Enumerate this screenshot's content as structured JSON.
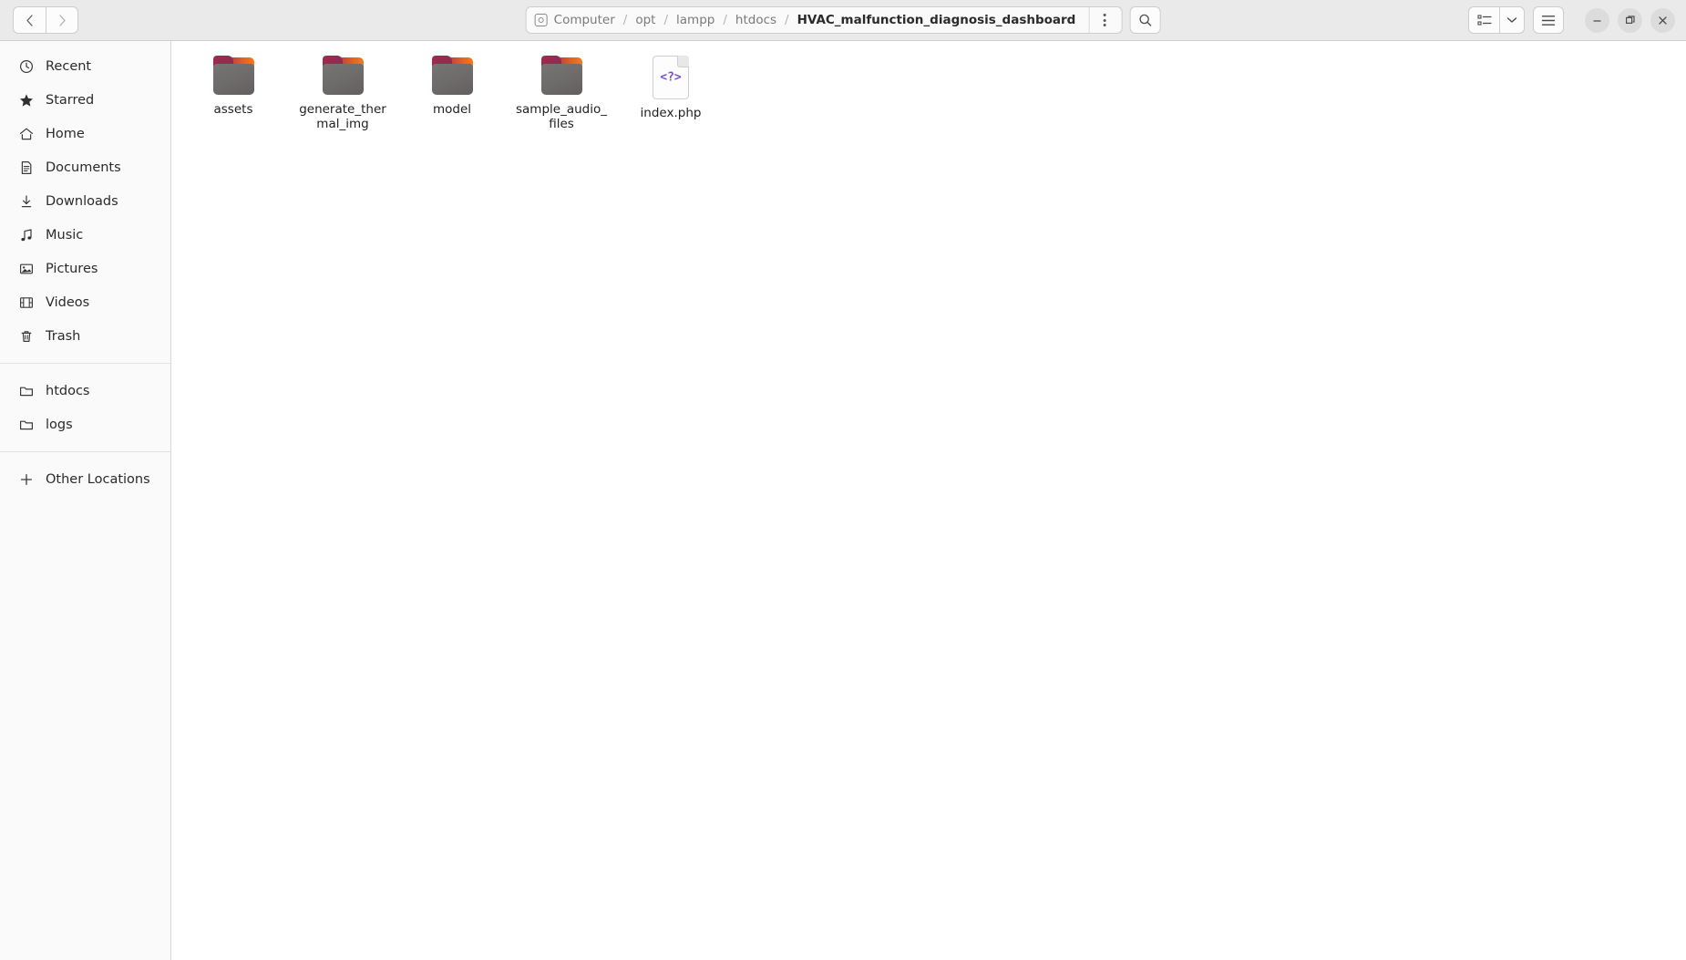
{
  "window": {
    "minimize_label": "—",
    "maximize_label": "❐",
    "close_label": "✕"
  },
  "toolbar": {
    "back_label": "‹",
    "forward_label": "›",
    "back_name": "back-button",
    "forward_name": "forward-button",
    "menu_dots": "⋮",
    "search_name": "search-icon",
    "view_toggle_name": "view-mode-toggle",
    "hamburger_name": "main-menu-button"
  },
  "breadcrumb": {
    "root_icon": "disk-icon",
    "segments": [
      {
        "label": "Computer",
        "current": false
      },
      {
        "label": "opt",
        "current": false
      },
      {
        "label": "lampp",
        "current": false
      },
      {
        "label": "htdocs",
        "current": false
      },
      {
        "label": "HVAC_malfunction_diagnosis_dashboard",
        "current": true
      }
    ],
    "separator": "/"
  },
  "sidebar": {
    "places": [
      {
        "label": "Recent",
        "icon": "clock-icon"
      },
      {
        "label": "Starred",
        "icon": "star-icon"
      },
      {
        "label": "Home",
        "icon": "home-icon"
      },
      {
        "label": "Documents",
        "icon": "document-icon"
      },
      {
        "label": "Downloads",
        "icon": "download-icon"
      },
      {
        "label": "Music",
        "icon": "music-note-icon"
      },
      {
        "label": "Pictures",
        "icon": "picture-icon"
      },
      {
        "label": "Videos",
        "icon": "film-icon"
      },
      {
        "label": "Trash",
        "icon": "trash-icon"
      }
    ],
    "bookmarks": [
      {
        "label": "htdocs",
        "icon": "folder-icon"
      },
      {
        "label": "logs",
        "icon": "folder-icon"
      }
    ],
    "other_locations": {
      "label": "Other Locations",
      "icon": "plus-icon"
    }
  },
  "files": [
    {
      "name": "assets",
      "type": "folder"
    },
    {
      "name": "generate_thermal_img",
      "type": "folder"
    },
    {
      "name": "model",
      "type": "folder"
    },
    {
      "name": "sample_audio_files",
      "type": "folder"
    },
    {
      "name": "index.php",
      "type": "php-file",
      "glyph": "<?>"
    }
  ],
  "colors": {
    "header_bg": "#eaeaea",
    "sidebar_bg": "#fafafa",
    "content_bg": "#ffffff",
    "folder_body": "#6d6a6a",
    "folder_tab": "#8e2b4e",
    "folder_accent": "#e8641e",
    "php_purple": "#7b4fd0"
  }
}
